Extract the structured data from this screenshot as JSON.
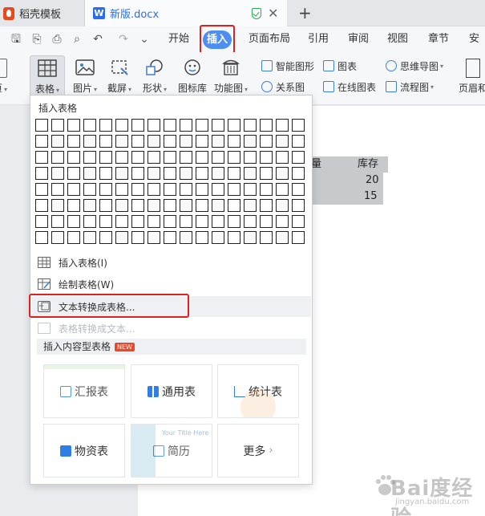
{
  "tabs": {
    "template_tab": "稻壳模板",
    "doc_tab": "新版.docx",
    "new_tab_icon": "plus-icon"
  },
  "menu": {
    "items": [
      "开始",
      "插入",
      "页面布局",
      "引用",
      "审阅",
      "视图",
      "章节",
      "安全"
    ],
    "active": "插入"
  },
  "ribbon": {
    "left_cut_label": "页",
    "table": "表格",
    "picture": "图片",
    "screenshot": "截屏",
    "shape": "形状",
    "iconlib": "图标库",
    "funcmap": "功能图",
    "smart_shape": "智能图形",
    "relation": "关系图",
    "chart": "图表",
    "online_chart": "在线图表",
    "mindmap": "思维导图",
    "flowchart": "流程图",
    "header_footer": "页眉和"
  },
  "document": {
    "header_qty": "量",
    "header_stock": "库存",
    "row1_stock": "20",
    "row2_stock": "15"
  },
  "dropdown": {
    "insert_table_title": "插入表格",
    "grid_cols": 17,
    "grid_rows": 8,
    "items": [
      {
        "label": "插入表格(I)",
        "state": "normal"
      },
      {
        "label": "绘制表格(W)",
        "state": "normal"
      },
      {
        "label": "文本转换成表格...",
        "state": "highlighted"
      },
      {
        "label": "表格转换成文本...",
        "state": "disabled"
      }
    ],
    "content_section": "插入内容型表格",
    "new_badge": "NEW",
    "cards": [
      {
        "label": "汇报表",
        "icon": "edit-icon",
        "color": "#2f7ee6"
      },
      {
        "label": "通用表",
        "icon": "grid-icon",
        "color": "#2f7ee6"
      },
      {
        "label": "统计表",
        "icon": "line-chart-icon",
        "color": "#2f7ee6"
      },
      {
        "label": "物资表",
        "icon": "box-icon",
        "color": "#2f7ee6"
      },
      {
        "label": "简历",
        "icon": "resume-icon",
        "color": "#2f7ee6"
      },
      {
        "label": "更多",
        "icon": "chevron-right-icon",
        "color": "#999999"
      }
    ],
    "ghost_text": "Your Title Here"
  },
  "watermark": {
    "main": "Bai度经验",
    "sub": "jingyan.baidu.com"
  },
  "colors": {
    "accent": "#4d8ef0",
    "highlight_border": "#e0201d",
    "new_badge": "#e8492b"
  }
}
